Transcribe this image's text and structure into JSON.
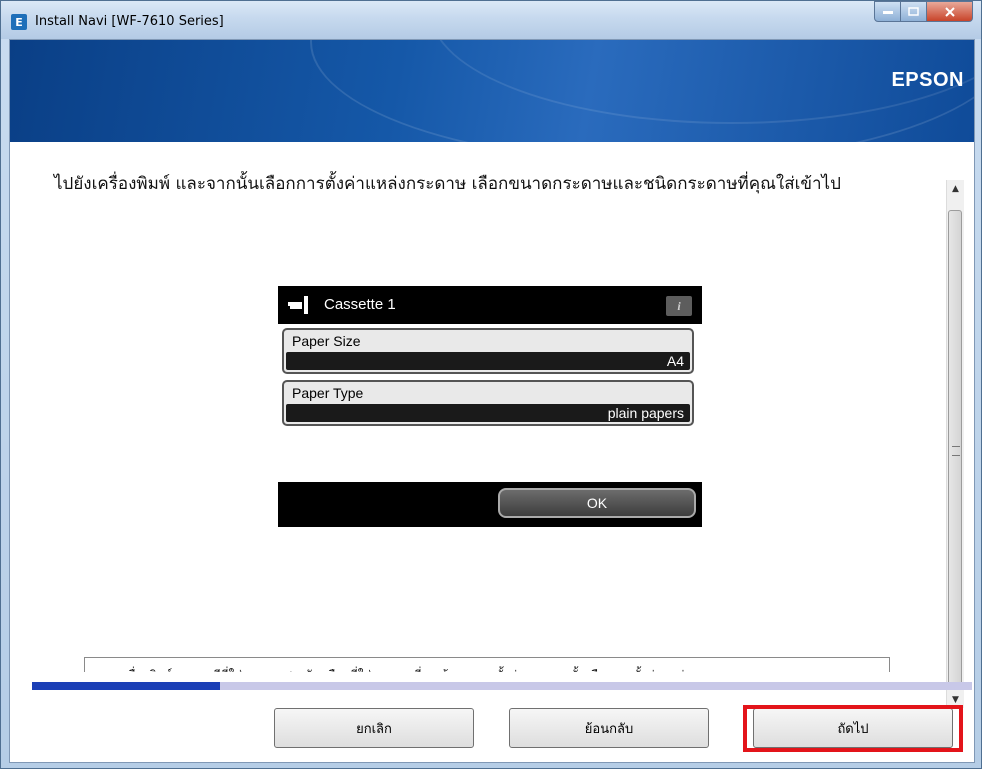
{
  "window": {
    "title": "Install Navi [WF-7610 Series]",
    "app_icon_letter": "E",
    "brand": "EPSON"
  },
  "instruction": "ไปยังเครื่องพิมพ์ และจากนั้นเลือกการตั้งค่าแหล่งกระดาษ เลือกขนาดกระดาษและชนิดกระดาษที่คุณใส่เข้าไป",
  "lcd": {
    "title": "Cassette 1",
    "info_icon": "i",
    "paper_size_label": "Paper Size",
    "paper_size_value": "A4",
    "paper_type_label": "Paper Type",
    "paper_type_value": "plain papers",
    "ok_label": "OK"
  },
  "note": "หากเครื่องพิมพ์ของคุณมีที่ใส่กระดาษสองอัน เลือกที่ใส่กระดาษที่คุณต้องการจะตั้งค่า และจากนั้นเลือกการตั้งค่าแหล่งกระดาษ",
  "progress": {
    "fraction": 0.2
  },
  "buttons": {
    "cancel": "ยกเลิก",
    "back": "ย้อนกลับ",
    "next": "ถัดไป"
  },
  "colors": {
    "highlight": "#e3141a",
    "header_blue": "#1558a8",
    "progress_fill": "#1b3fb6"
  }
}
